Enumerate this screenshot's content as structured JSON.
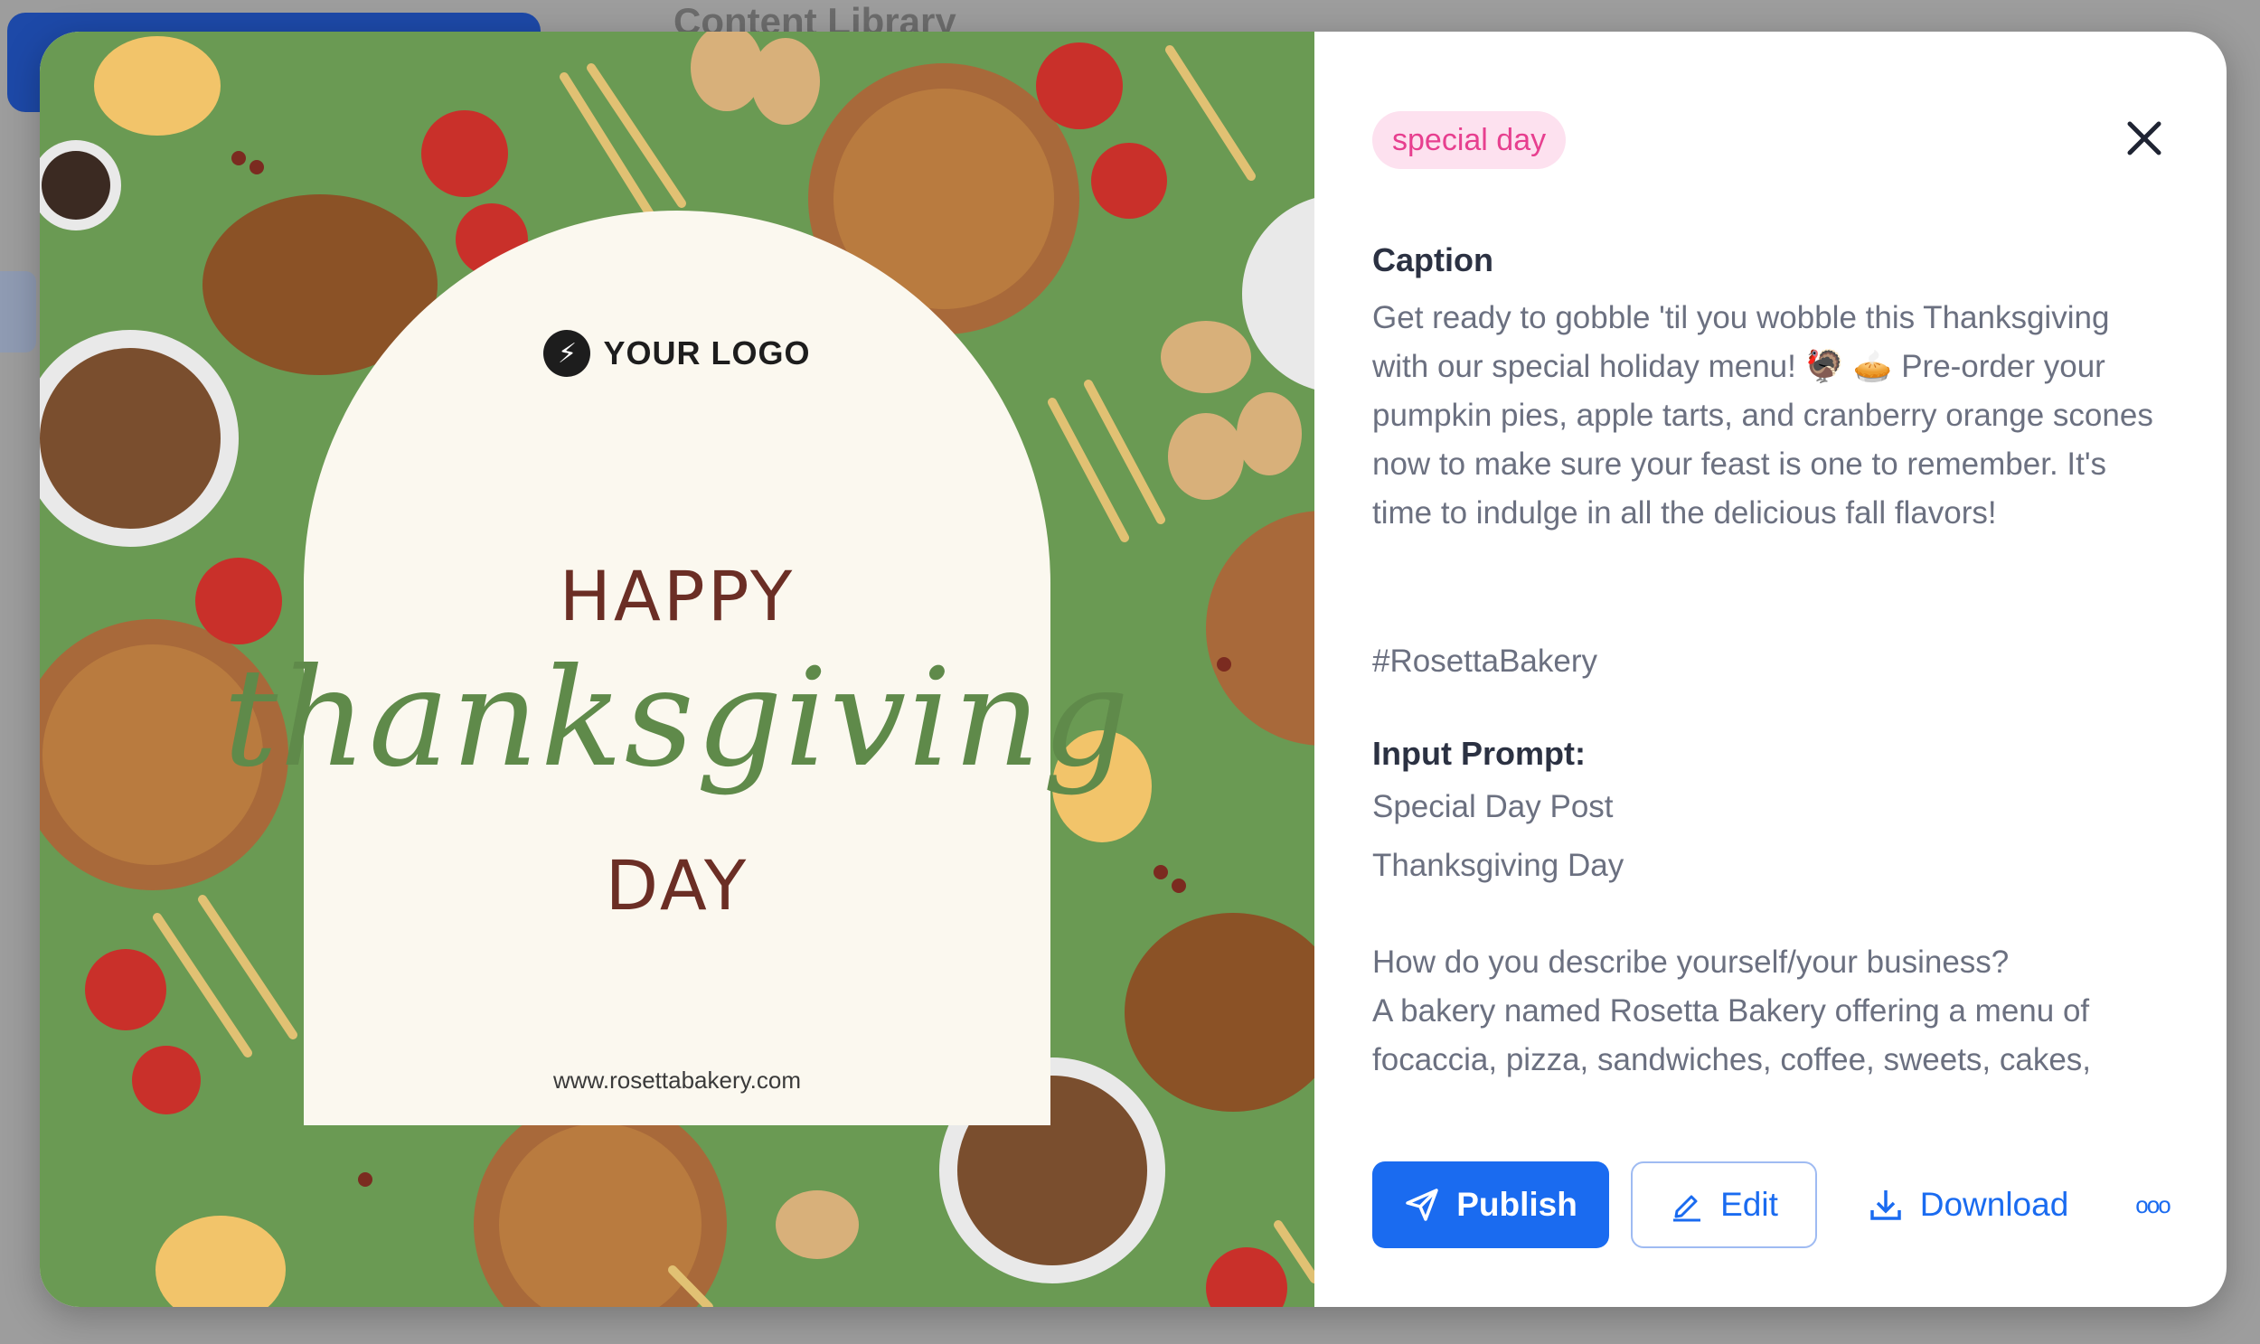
{
  "background": {
    "title": "Content Library"
  },
  "image": {
    "logo_text": "YOUR LOGO",
    "headline_top": "HAPPY",
    "headline_script": "thanksgiving",
    "headline_bottom": "DAY",
    "url": "www.rosettabakery.com"
  },
  "details": {
    "tag": "special day",
    "caption_title": "Caption",
    "caption_text": "Get ready to gobble 'til you wobble this Thanksgiving with our special holiday menu! 🦃 🥧 Pre-order your pumpkin pies, apple tarts, and cranberry orange scones now to make sure your feast is one to remember. It's time to indulge in all the delicious fall flavors!",
    "hashtag": "#RosettaBakery",
    "prompt_title": "Input Prompt:",
    "prompt_line_1": "Special Day Post",
    "prompt_line_2": "Thanksgiving Day",
    "question": "How do you describe yourself/your business?",
    "answer": "A bakery named Rosetta Bakery offering a menu of focaccia, pizza, sandwiches, coffee, sweets, cakes,"
  },
  "actions": {
    "publish": "Publish",
    "edit": "Edit",
    "download": "Download",
    "more": "ooo"
  },
  "colors": {
    "accent": "#1a6bf0",
    "tag_bg": "#fde1ef",
    "tag_text": "#e73f8f",
    "image_bg": "#6a9a53"
  }
}
